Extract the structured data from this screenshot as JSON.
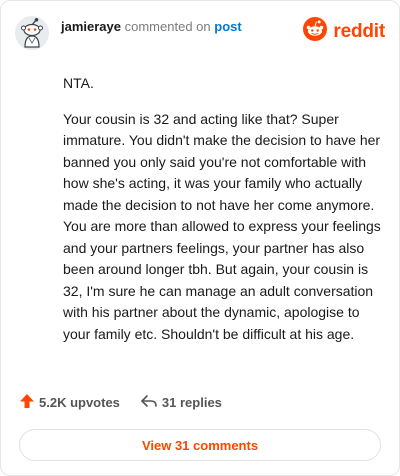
{
  "header": {
    "username": "jamieraye",
    "action_text": "commented on",
    "post_link": "post"
  },
  "logo": {
    "word": "reddit",
    "color": "#ff4500"
  },
  "comment": {
    "paragraphs": [
      "NTA.",
      "Your cousin is 32 and acting like that? Super immature. You didn't make the decision to have her banned you only said you're not comfortable with how she's acting, it was your family who actually made the decision to not have her come anymore. You are more than allowed to express your feelings and your partners feelings, your partner has also been around longer tbh. But again, your cousin is 32, I'm sure he can manage an adult conversation with his partner about the dynamic, apologise to your family etc. Shouldn't be difficult at his age."
    ]
  },
  "actions": {
    "upvotes": "5.2K upvotes",
    "replies": "31 replies"
  },
  "footer": {
    "view_comments": "View 31 comments"
  },
  "colors": {
    "accent": "#ff4500",
    "link": "#0079d3",
    "text": "#1a1a1b",
    "muted": "#7c7c7c"
  },
  "icons": {
    "avatar": "snoo-avatar-icon",
    "logo": "reddit-snoo-icon",
    "upvote": "upvote-arrow-icon",
    "reply": "reply-arrow-icon"
  }
}
